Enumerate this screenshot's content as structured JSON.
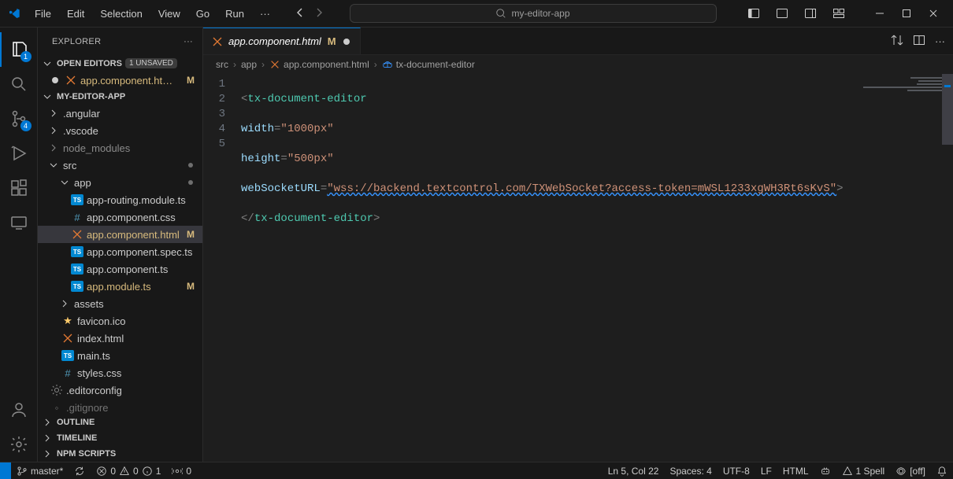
{
  "menu": {
    "file": "File",
    "edit": "Edit",
    "selection": "Selection",
    "view": "View",
    "go": "Go",
    "run": "Run",
    "more": "···"
  },
  "search": {
    "text": "my-editor-app"
  },
  "activity": {
    "explorer_badge": "1",
    "scm_badge": "4"
  },
  "sidebar": {
    "title": "EXPLORER",
    "open_editors": "OPEN EDITORS",
    "unsaved": "1 unsaved",
    "open_editor_item": "app.component.ht…",
    "open_editor_mod": "M",
    "workspace": "MY-EDITOR-APP",
    "tree": {
      "angular": ".angular",
      "vscode": ".vscode",
      "node_modules": "node_modules",
      "src": "src",
      "app": "app",
      "app_routing": "app-routing.module.ts",
      "app_css": "app.component.css",
      "app_html": "app.component.html",
      "app_html_mod": "M",
      "app_spec": "app.component.spec.ts",
      "app_ts": "app.component.ts",
      "app_module": "app.module.ts",
      "app_module_mod": "M",
      "assets": "assets",
      "favicon": "favicon.ico",
      "index": "index.html",
      "main": "main.ts",
      "styles": "styles.css",
      "editorconfig": ".editorconfig",
      "gitignore": ".gitignore"
    },
    "outline": "OUTLINE",
    "timeline": "TIMELINE",
    "npm": "NPM SCRIPTS"
  },
  "tab": {
    "name": "app.component.html",
    "mod": "M"
  },
  "breadcrumb": {
    "src": "src",
    "app": "app",
    "file": "app.component.html",
    "sym": "tx-document-editor"
  },
  "code": {
    "l1a": "<",
    "l1b": "tx-document-editor",
    "l2a": "width",
    "l2b": "=",
    "l2c": "\"1000px\"",
    "l3a": "height",
    "l3b": "=",
    "l3c": "\"500px\"",
    "l4a": "webSocketURL",
    "l4b": "=",
    "l4c": "\"wss://backend.textcontrol.com/TXWebSocket?access-token=mWSL1233xgWH3Rt6sKvS\"",
    "l4d": ">",
    "l5a": "</",
    "l5b": "tx-document-editor",
    "l5c": ">",
    "ln1": "1",
    "ln2": "2",
    "ln3": "3",
    "ln4": "4",
    "ln5": "5"
  },
  "status": {
    "branch": "master*",
    "sync": "",
    "errors": "0",
    "warnings": "0",
    "info": "1",
    "ports": "0",
    "lncol": "Ln 5, Col 22",
    "spaces": "Spaces: 4",
    "encoding": "UTF-8",
    "eol": "LF",
    "lang": "HTML",
    "spell": "1 Spell",
    "eye": "[off]"
  }
}
